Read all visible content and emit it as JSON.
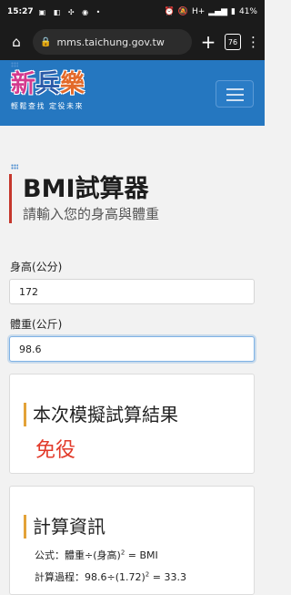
{
  "status_bar": {
    "time": "15:27",
    "battery": "41%",
    "network": "H+"
  },
  "browser": {
    "url": "mms.taichung.gov.tw",
    "tab_count": "76"
  },
  "site": {
    "logo_chars": [
      "新",
      "兵",
      "樂"
    ],
    "slogan": "輕鬆查找 定役未來"
  },
  "page": {
    "title": "BMI試算器",
    "subtitle": "請輸入您的身高與體重"
  },
  "form": {
    "height_label": "身高(公分)",
    "height_value": "172",
    "weight_label": "體重(公斤)",
    "weight_value": "98.6"
  },
  "result": {
    "title": "本次模擬試算結果",
    "value": "免役"
  },
  "calc": {
    "title": "計算資訊",
    "formula_prefix": "公式：體重÷(身高)",
    "formula_sup": "2",
    "formula_suffix": " = BMI",
    "process_prefix": "計算過程：98.6÷(1.72)",
    "process_sup": "2",
    "process_suffix": " = 33.3"
  }
}
